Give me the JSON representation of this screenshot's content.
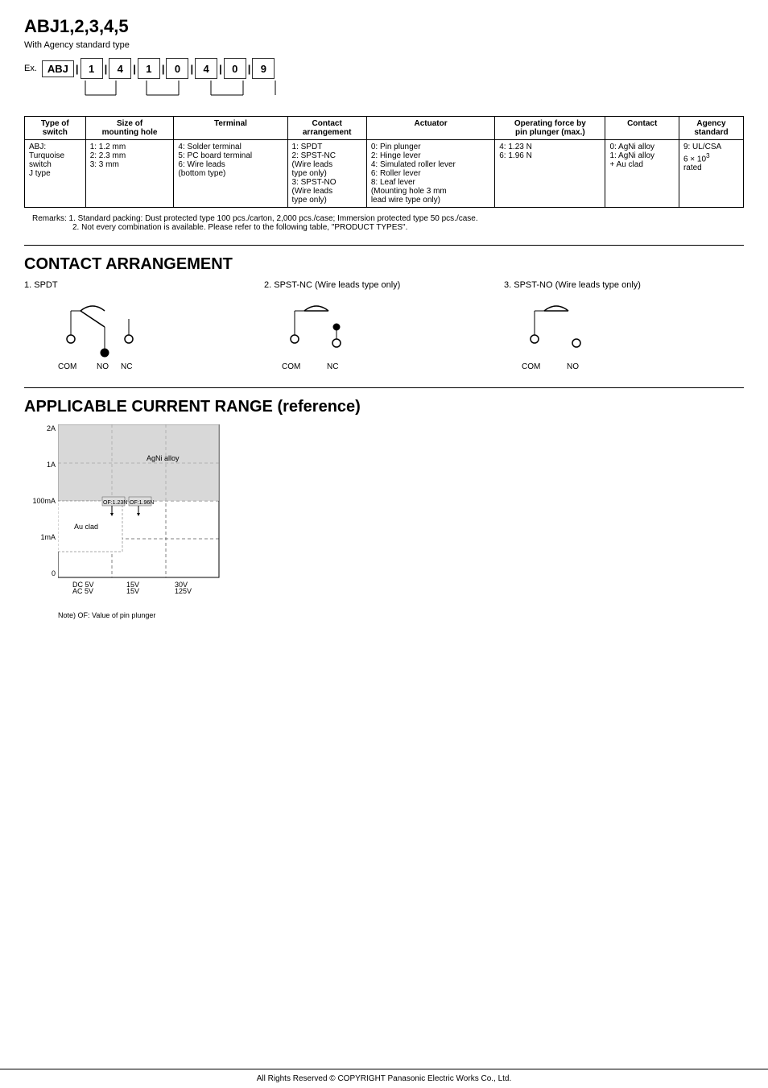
{
  "page": {
    "title": "ABJ1,2,3,4,5",
    "subtitle": "With Agency standard type"
  },
  "example": {
    "prefix": "Ex.",
    "code_label": "ABJ",
    "boxes": [
      "1",
      "4",
      "1",
      "0",
      "4",
      "0",
      "9"
    ]
  },
  "table": {
    "headers": [
      "Type of switch",
      "Size of mounting hole",
      "Terminal",
      "Contact arrangement",
      "Actuator",
      "Operating force by pin plunger (max.)",
      "Contact",
      "Agency standard"
    ],
    "rows": [
      {
        "col1": "ABJ:\nTurquoise switch\nJ type",
        "col2": "1: 1.2 mm\n2: 2.3 mm\n3: 3 mm",
        "col3": "4: Solder terminal\n5: PC board terminal\n6: Wire leads\n(bottom type)",
        "col4": "1: SPDT\n2: SPST-NC\n(Wire leads type only)\n3: SPST-NO\n(Wire leads type only)",
        "col5": "0: Pin plunger\n2: Hinge lever\n4: Simulated roller lever\n6: Roller lever\n8: Leaf lever\n(Mounting hole 3 mm lead wire type only)",
        "col6": "4: 1.23 N\n6: 1.96 N",
        "col7": "0: AgNi alloy\n1: AgNi alloy\n+ Au clad",
        "col8": "9: UL/CSA\n6 × 10³ rated"
      }
    ]
  },
  "remarks": {
    "lines": [
      "Remarks:  1. Standard packing:   Dust protected type 100 pcs./carton, 2,000 pcs./case; Immersion protected type 50 pcs./case.",
      "               2. Not every combination is available. Please refer to the following table, \"PRODUCT TYPES\"."
    ]
  },
  "contact_arrangement": {
    "section_title": "CONTACT ARRANGEMENT",
    "diagrams": [
      {
        "id": "spdt",
        "label": "1. SPDT",
        "pins": [
          "COM",
          "NO",
          "NC"
        ]
      },
      {
        "id": "spst-nc",
        "label": "2. SPST-NC (Wire leads type only)",
        "pins": [
          "COM",
          "NC"
        ]
      },
      {
        "id": "spst-no",
        "label": "3. SPST-NO (Wire leads type only)",
        "pins": [
          "COM",
          "NO"
        ]
      }
    ]
  },
  "current_range": {
    "section_title": "APPLICABLE CURRENT RANGE (reference)",
    "y_labels": [
      "2A",
      "1A",
      "100mA",
      "1mA",
      "0"
    ],
    "x_labels": [
      {
        "line1": "DC  5V",
        "line2": "AC  5V"
      },
      {
        "line1": "15V",
        "line2": "15V"
      },
      {
        "line1": "30V",
        "line2": "125V"
      }
    ],
    "regions": [
      {
        "label": "AgNi alloy",
        "color": "#ccc"
      },
      {
        "label": "Au clad",
        "color": "#fff"
      }
    ],
    "annotations": [
      "OF:1.23N",
      "OF:1.96N"
    ],
    "note": "Note) OF: Value of pin plunger"
  },
  "footer": {
    "text": "All Rights Reserved © COPYRIGHT Panasonic Electric Works Co., Ltd."
  }
}
